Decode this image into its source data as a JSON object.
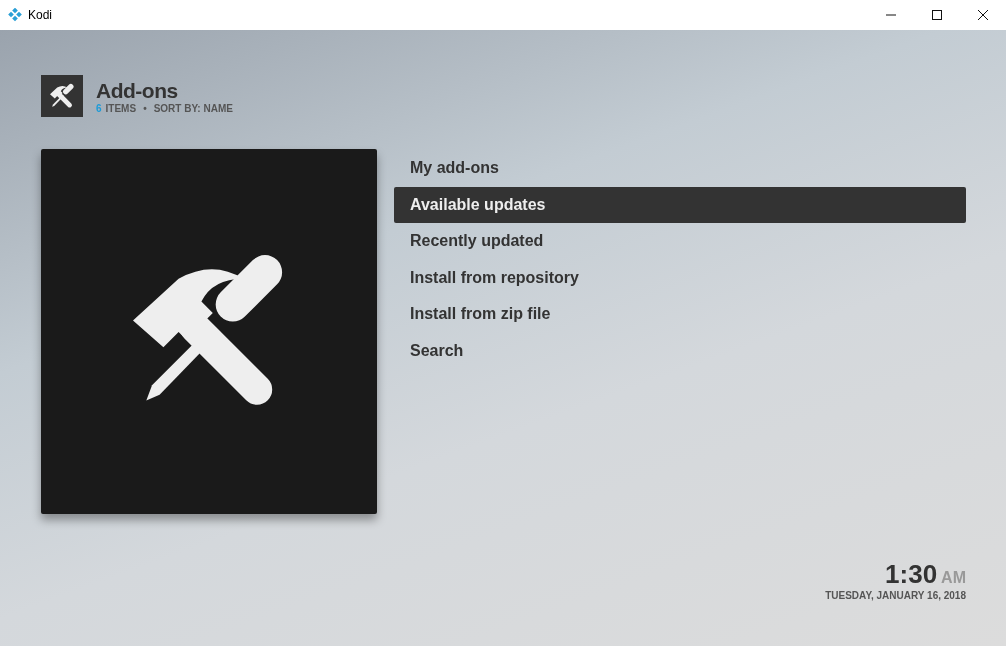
{
  "window": {
    "title": "Kodi"
  },
  "header": {
    "title": "Add-ons",
    "count": "6",
    "count_label": "ITEMS",
    "separator": "•",
    "sort": "SORT BY: NAME"
  },
  "menu": [
    {
      "label": "My add-ons",
      "selected": false
    },
    {
      "label": "Available updates",
      "selected": true
    },
    {
      "label": "Recently updated",
      "selected": false
    },
    {
      "label": "Install from repository",
      "selected": false
    },
    {
      "label": "Install from zip file",
      "selected": false
    },
    {
      "label": "Search",
      "selected": false
    }
  ],
  "clock": {
    "time": "1:30",
    "meridiem": "AM",
    "date": "TUESDAY, JANUARY 16, 2018"
  }
}
